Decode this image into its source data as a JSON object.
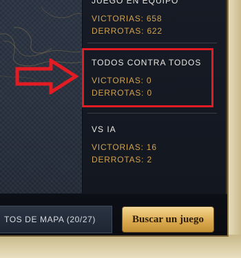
{
  "groups": [
    {
      "title": "JUEGO EN EQUIPO",
      "victories": "VICTORIAS: 658",
      "defeats": "DERROTAS: 622"
    },
    {
      "title": "TODOS CONTRA TODOS",
      "victories": "VICTORIAS: 0",
      "defeats": "DERROTAS: 0"
    },
    {
      "title": "VS IA",
      "victories": "VICTORIAS: 16",
      "defeats": "DERROTAS: 2"
    }
  ],
  "footer": {
    "map_button_label": "TOS DE MAPA (20/27)",
    "search_button_label": "Buscar un juego"
  },
  "annotation": {
    "arrow_icon": "arrow-right-icon",
    "color": "#e31b23"
  },
  "colors": {
    "accent_gold": "#d2a24f",
    "panel": "#13161f",
    "highlight": "#e31b23"
  }
}
